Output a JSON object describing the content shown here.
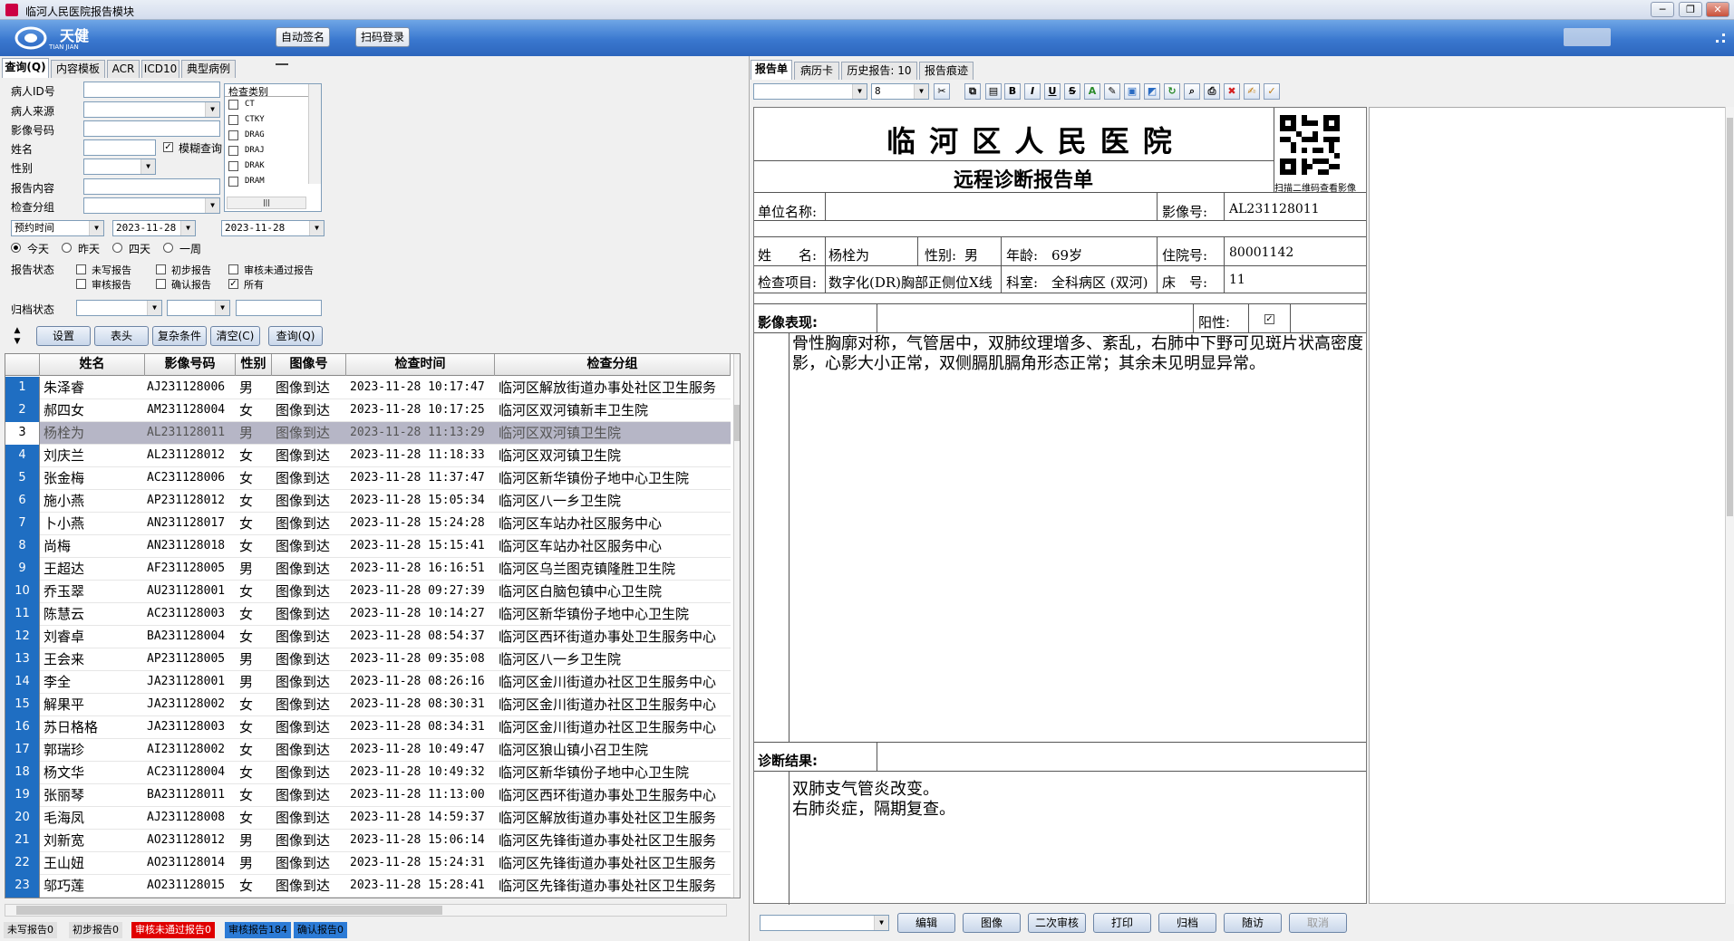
{
  "window": {
    "title": "临河人民医院报告模块"
  },
  "banner": {
    "logo_text": "天健",
    "logo_sub": "TIAN JIAN",
    "btn_auto_sign": "自动签名",
    "btn_scan_login": "扫码登录"
  },
  "left_tabs": [
    "查询(Q)",
    "内容模板",
    "ACR",
    "ICD10",
    "典型病例"
  ],
  "search": {
    "patient_id_label": "病人ID号",
    "source_label": "病人来源",
    "image_no_label": "影像号码",
    "name_label": "姓名",
    "fuzzy_label": "模糊查询",
    "gender_label": "性别",
    "content_label": "报告内容",
    "group_label": "检查分组",
    "category_title": "检查类别",
    "categories": [
      "CT",
      "CTKY",
      "DRAG",
      "DRAJ",
      "DRAK",
      "DRAM"
    ],
    "time_type": "预约时间",
    "date_from": "2023-11-28",
    "date_to": "2023-11-28",
    "radio_today": "今天",
    "radio_yesterday": "昨天",
    "radio_four_days": "四天",
    "radio_week": "一周",
    "report_state_label": "报告状态",
    "st_unwritten": "未写报告",
    "st_initial": "初步报告",
    "st_audit_fail": "审核未通过报告",
    "st_audited": "审核报告",
    "st_confirmed": "确认报告",
    "st_all": "所有",
    "archive_label": "归档状态",
    "btn_settings": "设置",
    "btn_header": "表头",
    "btn_complex": "复杂条件",
    "btn_clear": "清空(C)",
    "btn_query": "查询(Q)"
  },
  "grid": {
    "headers": [
      "姓名",
      "影像号码",
      "性别",
      "图像号",
      "检查时间",
      "检查分组"
    ],
    "rows": [
      {
        "no": "1",
        "name": "朱泽睿",
        "code": "AJ231128006",
        "sex": "男",
        "img": "图像到达",
        "time": "2023-11-28 10:17:47",
        "group": "临河区解放街道办事处社区卫生服务"
      },
      {
        "no": "2",
        "name": "郝四女",
        "code": "AM231128004",
        "sex": "女",
        "img": "图像到达",
        "time": "2023-11-28 10:17:25",
        "group": "临河区双河镇新丰卫生院"
      },
      {
        "no": "3",
        "name": "杨栓为",
        "code": "AL231128011",
        "sex": "男",
        "img": "图像到达",
        "time": "2023-11-28 11:13:29",
        "group": "临河区双河镇卫生院"
      },
      {
        "no": "4",
        "name": "刘庆兰",
        "code": "AL231128012",
        "sex": "女",
        "img": "图像到达",
        "time": "2023-11-28 11:18:33",
        "group": "临河区双河镇卫生院"
      },
      {
        "no": "5",
        "name": "张金梅",
        "code": "AC231128006",
        "sex": "女",
        "img": "图像到达",
        "time": "2023-11-28 11:37:47",
        "group": "临河区新华镇份子地中心卫生院"
      },
      {
        "no": "6",
        "name": "施小燕",
        "code": "AP231128012",
        "sex": "女",
        "img": "图像到达",
        "time": "2023-11-28 15:05:34",
        "group": "临河区八一乡卫生院"
      },
      {
        "no": "7",
        "name": "卜小燕",
        "code": "AN231128017",
        "sex": "女",
        "img": "图像到达",
        "time": "2023-11-28 15:24:28",
        "group": "临河区车站办社区服务中心"
      },
      {
        "no": "8",
        "name": "尚梅",
        "code": "AN231128018",
        "sex": "女",
        "img": "图像到达",
        "time": "2023-11-28 15:15:41",
        "group": "临河区车站办社区服务中心"
      },
      {
        "no": "9",
        "name": "王超达",
        "code": "AF231128005",
        "sex": "男",
        "img": "图像到达",
        "time": "2023-11-28 16:16:51",
        "group": "临河区乌兰图克镇隆胜卫生院"
      },
      {
        "no": "10",
        "name": "乔玉翠",
        "code": "AU231128001",
        "sex": "女",
        "img": "图像到达",
        "time": "2023-11-28 09:27:39",
        "group": "临河区白脑包镇中心卫生院"
      },
      {
        "no": "11",
        "name": "陈慧云",
        "code": "AC231128003",
        "sex": "女",
        "img": "图像到达",
        "time": "2023-11-28 10:14:27",
        "group": "临河区新华镇份子地中心卫生院"
      },
      {
        "no": "12",
        "name": "刘睿卓",
        "code": "BA231128004",
        "sex": "女",
        "img": "图像到达",
        "time": "2023-11-28 08:54:37",
        "group": "临河区西环街道办事处卫生服务中心"
      },
      {
        "no": "13",
        "name": "王会来",
        "code": "AP231128005",
        "sex": "男",
        "img": "图像到达",
        "time": "2023-11-28 09:35:08",
        "group": "临河区八一乡卫生院"
      },
      {
        "no": "14",
        "name": "李全",
        "code": "JA231128001",
        "sex": "男",
        "img": "图像到达",
        "time": "2023-11-28 08:26:16",
        "group": "临河区金川街道办社区卫生服务中心"
      },
      {
        "no": "15",
        "name": "解果平",
        "code": "JA231128002",
        "sex": "女",
        "img": "图像到达",
        "time": "2023-11-28 08:30:31",
        "group": "临河区金川街道办社区卫生服务中心"
      },
      {
        "no": "16",
        "name": "苏日格格",
        "code": "JA231128003",
        "sex": "女",
        "img": "图像到达",
        "time": "2023-11-28 08:34:31",
        "group": "临河区金川街道办社区卫生服务中心"
      },
      {
        "no": "17",
        "name": "郭瑞珍",
        "code": "AI231128002",
        "sex": "女",
        "img": "图像到达",
        "time": "2023-11-28 10:49:47",
        "group": "临河区狼山镇小召卫生院"
      },
      {
        "no": "18",
        "name": "杨文华",
        "code": "AC231128004",
        "sex": "女",
        "img": "图像到达",
        "time": "2023-11-28 10:49:32",
        "group": "临河区新华镇份子地中心卫生院"
      },
      {
        "no": "19",
        "name": "张丽琴",
        "code": "BA231128011",
        "sex": "女",
        "img": "图像到达",
        "time": "2023-11-28 11:13:00",
        "group": "临河区西环街道办事处卫生服务中心"
      },
      {
        "no": "20",
        "name": "毛海凤",
        "code": "AJ231128008",
        "sex": "女",
        "img": "图像到达",
        "time": "2023-11-28 14:59:37",
        "group": "临河区解放街道办事处社区卫生服务"
      },
      {
        "no": "21",
        "name": "刘新宽",
        "code": "AO231128012",
        "sex": "男",
        "img": "图像到达",
        "time": "2023-11-28 15:06:14",
        "group": "临河区先锋街道办事处社区卫生服务"
      },
      {
        "no": "22",
        "name": "王山妞",
        "code": "AO231128014",
        "sex": "男",
        "img": "图像到达",
        "time": "2023-11-28 15:24:31",
        "group": "临河区先锋街道办事处社区卫生服务"
      },
      {
        "no": "23",
        "name": "邬巧莲",
        "code": "AO231128015",
        "sex": "女",
        "img": "图像到达",
        "time": "2023-11-28 15:28:41",
        "group": "临河区先锋街道办事处社区卫生服务"
      }
    ]
  },
  "status_bar": {
    "unwritten": "未写报告0",
    "initial": "初步报告0",
    "audit_fail": "审核未通过报告0",
    "audited": "审核报告184",
    "confirmed": "确认报告0"
  },
  "right_tabs": [
    "报告单",
    "病历卡",
    "历史报告: 10",
    "报告痕迹"
  ],
  "toolbar": {
    "font_size": "8"
  },
  "report": {
    "hospital": "临 河 区 人 民 医 院",
    "subtitle": "远程诊断报告单",
    "qr_caption": "扫描二维码查看影像",
    "unit_label": "单位名称:",
    "unit_value": "",
    "image_no_label": "影像号:",
    "image_no": "AL231128011",
    "name_label": "姓　　名:",
    "name": "杨栓为",
    "sex_label": "性别:",
    "sex": "男",
    "age_label": "年龄:",
    "age": "69岁",
    "inpatient_label": "住院号:",
    "inpatient_no": "80001142",
    "exam_label": "检查项目:",
    "exam": "数字化(DR)胸部正侧位X线",
    "dept_label": "科室:",
    "dept": "全科病区 (双河)",
    "bed_label": "床　号:",
    "bed": "11",
    "findings_label": "影像表现:",
    "positive_label": "阳性:",
    "positive_mark": "✓",
    "findings": "骨性胸廓对称，气管居中，双肺纹理增多、紊乱，右肺中下野可见斑片状高密度影，心影大小正常，双侧膈肌膈角形态正常；其余未见明显异常。",
    "diagnosis_label": "诊断结果:",
    "diagnosis_line1": "双肺支气管炎改变。",
    "diagnosis_line2": "右肺炎症，隔期复查。"
  },
  "footer_buttons": {
    "edit": "编辑",
    "image": "图像",
    "second_audit": "二次审核",
    "print": "打印",
    "archive": "归档",
    "follow_up": "随访",
    "cancel": "取消"
  }
}
